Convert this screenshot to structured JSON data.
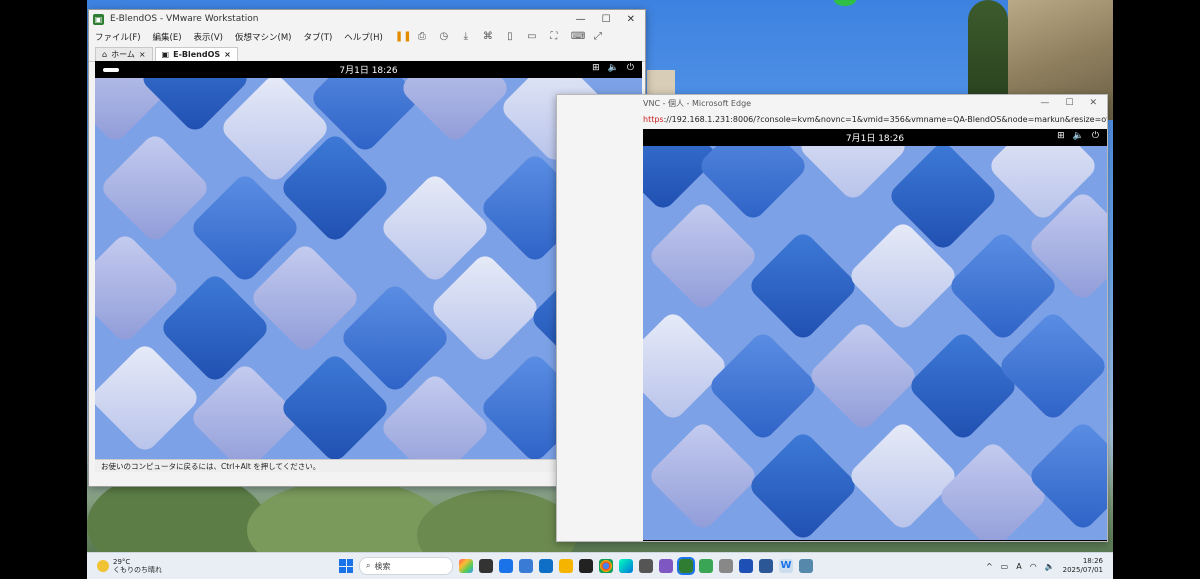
{
  "vmware": {
    "title": "E-BlendOS - VMware Workstation",
    "window_controls": [
      "—",
      "☐",
      "✕"
    ],
    "menu": [
      "ファイル(F)",
      "編集(E)",
      "表示(V)",
      "仮想マシン(M)",
      "タブ(T)",
      "ヘルプ(H)"
    ],
    "tabs": [
      {
        "label": "ホーム"
      },
      {
        "label": "E-BlendOS"
      }
    ],
    "guest_clock": "7月1日  18:26",
    "status_hint": "お使いのコンピュータに戻るには、Ctrl+Alt を押してください。"
  },
  "edge": {
    "title": "VNC - 個人 - Microsoft Edge",
    "url_proto": "https",
    "url_rest": "://192.168.1.231:8006/?console=kvm&novnc=1&vmid=356&vmname=QA-BlendOS&node=markun&resize=off",
    "guest_clock": "7月1日  18:26"
  },
  "taskbar": {
    "weather_temp": "29°C",
    "weather_desc": "くもりのち晴れ",
    "search_placeholder": "検索",
    "time": "18:26",
    "date": "2025/07/01"
  },
  "colors": {
    "accent": "#1a73e8",
    "vm_green": "#2f7d32"
  }
}
